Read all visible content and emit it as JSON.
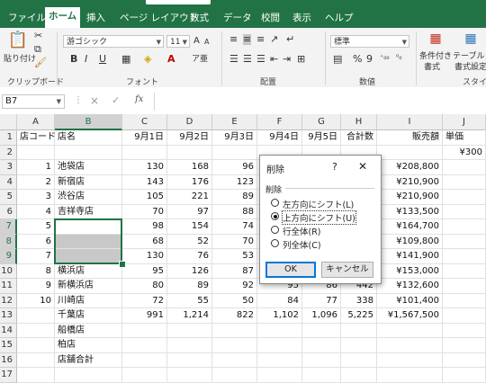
{
  "tabs": [
    "ファイル",
    "ホーム",
    "挿入",
    "ページ レイアウト",
    "数式",
    "データ",
    "校閲",
    "表示",
    "ヘルプ"
  ],
  "active_tab": "ホーム",
  "ribbon": {
    "paste_label": "貼り付け",
    "clipboard_group": "クリップボード",
    "font_name": "游ゴシック",
    "font_size": "11",
    "font_group": "フォント",
    "align_group": "配置",
    "number_format": "標準",
    "number_group": "数値",
    "cond_format_label_1": "条件付き",
    "cond_format_label_2": "書式",
    "table_format_label_1": "テーブルとし",
    "table_format_label_2": "書式設定",
    "style_group": "スタイル",
    "bold": "B",
    "italic": "I",
    "underline": "U",
    "font_grow": "A",
    "font_shrink": "A",
    "percent": "%",
    "comma": "9"
  },
  "formula_bar": {
    "name_box": "B7",
    "fx": "fx",
    "cancel": "×",
    "enter": "✓",
    "formula": ""
  },
  "columns": [
    "A",
    "B",
    "C",
    "D",
    "E",
    "F",
    "G",
    "H",
    "I",
    "J"
  ],
  "rows": [
    {
      "n": "1",
      "cells": [
        "店コード",
        "店名",
        "9月1日",
        "9月2日",
        "9月3日",
        "9月4日",
        "9月5日",
        "合計数",
        "販売額",
        "単価"
      ]
    },
    {
      "n": "2",
      "cells": [
        "",
        "",
        "",
        "",
        "",
        "",
        "",
        "",
        "",
        "¥300"
      ]
    },
    {
      "n": "3",
      "cells": [
        "1",
        "池袋店",
        "130",
        "168",
        "96",
        "",
        "",
        "",
        "¥208,800",
        ""
      ]
    },
    {
      "n": "4",
      "cells": [
        "2",
        "新宿店",
        "143",
        "176",
        "123",
        "",
        "",
        "",
        "¥210,900",
        ""
      ]
    },
    {
      "n": "5",
      "cells": [
        "3",
        "渋谷店",
        "105",
        "221",
        "89",
        "",
        "",
        "",
        "¥210,900",
        ""
      ]
    },
    {
      "n": "6",
      "cells": [
        "4",
        "吉祥寺店",
        "70",
        "97",
        "88",
        "",
        "",
        "",
        "¥133,500",
        ""
      ]
    },
    {
      "n": "7",
      "cells": [
        "5",
        "",
        "98",
        "154",
        "74",
        "",
        "",
        "",
        "¥164,700",
        ""
      ]
    },
    {
      "n": "8",
      "cells": [
        "6",
        "",
        "68",
        "52",
        "70",
        "",
        "",
        "",
        "¥109,800",
        ""
      ]
    },
    {
      "n": "9",
      "cells": [
        "7",
        "",
        "130",
        "76",
        "53",
        "",
        "",
        "",
        "¥141,900",
        ""
      ]
    },
    {
      "n": "10",
      "cells": [
        "8",
        "横浜店",
        "95",
        "126",
        "87",
        "",
        "",
        "",
        "¥153,000",
        ""
      ]
    },
    {
      "n": "11",
      "cells": [
        "9",
        "新横浜店",
        "80",
        "89",
        "92",
        "95",
        "86",
        "442",
        "¥132,600",
        ""
      ]
    },
    {
      "n": "12",
      "cells": [
        "10",
        "川崎店",
        "72",
        "55",
        "50",
        "84",
        "77",
        "338",
        "¥101,400",
        ""
      ]
    },
    {
      "n": "13",
      "cells": [
        "",
        "千葉店",
        "991",
        "1,214",
        "822",
        "1,102",
        "1,096",
        "5,225",
        "¥1,567,500",
        ""
      ]
    },
    {
      "n": "14",
      "cells": [
        "",
        "船橋店",
        "",
        "",
        "",
        "",
        "",
        "",
        "",
        ""
      ]
    },
    {
      "n": "15",
      "cells": [
        "",
        "柏店",
        "",
        "",
        "",
        "",
        "",
        "",
        "",
        ""
      ]
    },
    {
      "n": "16",
      "cells": [
        "",
        "店舗合計",
        "",
        "",
        "",
        "",
        "",
        "",
        "",
        ""
      ]
    },
    {
      "n": "17",
      "cells": [
        "",
        "",
        "",
        "",
        "",
        "",
        "",
        "",
        "",
        ""
      ]
    }
  ],
  "dialog": {
    "title": "削除",
    "help": "?",
    "close": "✕",
    "section": "削除",
    "options": [
      "左方向にシフト(L)",
      "上方向にシフト(U)",
      "行全体(R)",
      "列全体(C)"
    ],
    "selected_index": 1,
    "ok": "OK",
    "cancel": "キャンセル"
  }
}
